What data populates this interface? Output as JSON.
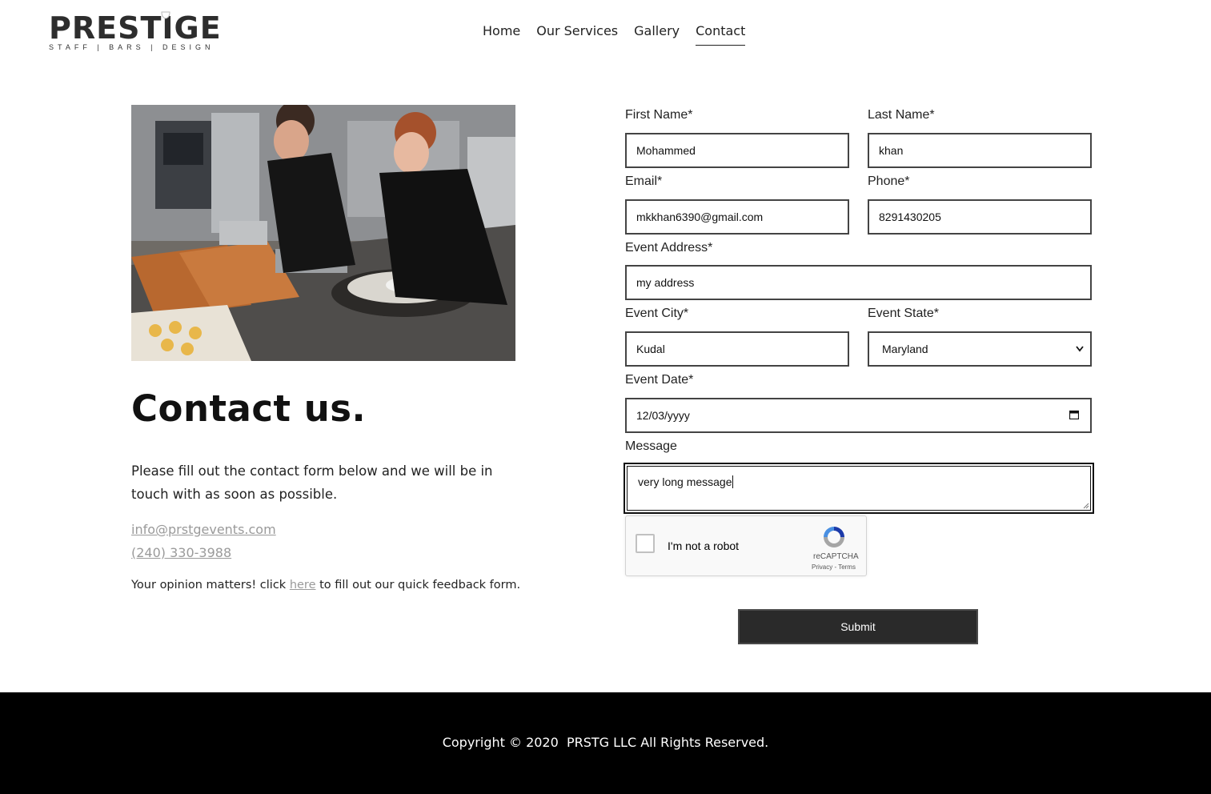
{
  "header": {
    "logo_text": "PRESTIGE",
    "logo_tagline": "STAFF | BARS | DESIGN",
    "nav": [
      {
        "label": "Home"
      },
      {
        "label": "Our Services"
      },
      {
        "label": "Gallery"
      },
      {
        "label": "Contact",
        "active": true
      }
    ]
  },
  "intro": {
    "heading": "Contact us.",
    "body": "Please fill out the contact form below and we will be in touch with as soon as possible.",
    "email": "info@prstgevents.com",
    "phone": "(240) 330-3988",
    "feedback_before": "Your opinion matters! click ",
    "feedback_link": "here",
    "feedback_after": " to fill out our quick feedback form."
  },
  "form": {
    "first_name": {
      "label": "First Name*",
      "value": "Mohammed"
    },
    "last_name": {
      "label": "Last Name*",
      "value": "khan"
    },
    "email": {
      "label": "Email*",
      "value": "mkkhan6390@gmail.com"
    },
    "phone": {
      "label": "Phone*",
      "value": "8291430205"
    },
    "address": {
      "label": "Event Address*",
      "value": "my address"
    },
    "city": {
      "label": "Event City*",
      "value": "Kudal"
    },
    "state": {
      "label": "Event State*",
      "value": "Maryland"
    },
    "date": {
      "label": "Event Date*",
      "value": "12/03/yyyy"
    },
    "message": {
      "label": "Message",
      "value": "very long message"
    },
    "recaptcha": {
      "label": "I'm not a robot",
      "brand": "reCAPTCHA",
      "terms": "Privacy - Terms"
    },
    "submit_label": "Submit"
  },
  "footer": {
    "copyright": "Copyright © 2020  PRSTG LLC All Rights Reserved."
  },
  "colors": {
    "text": "#222222",
    "link_muted": "#9a9a9a",
    "button_bg": "#2a2a2a",
    "footer_bg": "#000000"
  }
}
